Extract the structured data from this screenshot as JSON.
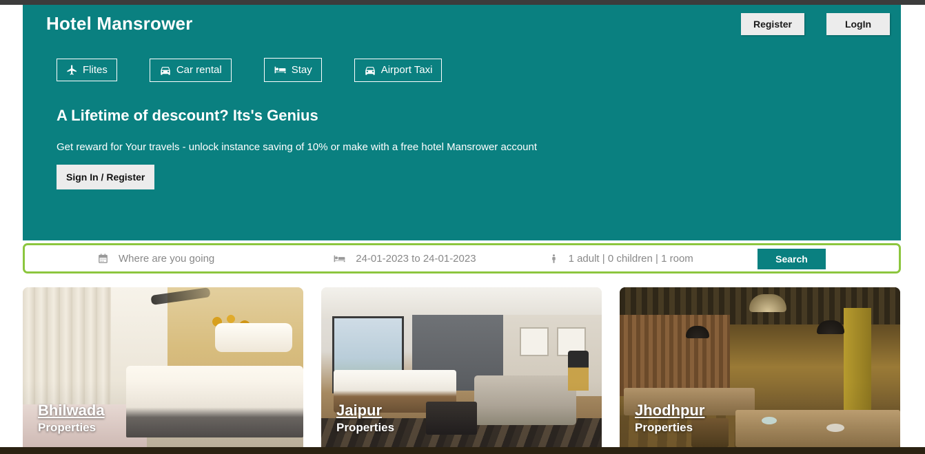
{
  "header": {
    "brand": "Hotel Mansrower",
    "register_label": "Register",
    "login_label": "LogIn"
  },
  "nav": {
    "items": [
      {
        "label": "Flites",
        "icon": "plane-icon"
      },
      {
        "label": "Car rental",
        "icon": "car-icon"
      },
      {
        "label": "Stay",
        "icon": "bed-icon"
      },
      {
        "label": "Airport Taxi",
        "icon": "taxi-icon"
      }
    ]
  },
  "promo": {
    "title": "A Lifetime of descount? Its's Genius",
    "subtitle": "Get reward for Your travels - unlock instance saving of 10% or make with a free hotel Mansrower account",
    "button_label": "Sign In / Register"
  },
  "search": {
    "destination_placeholder": "Where are you going",
    "destination_icon": "calendar-icon",
    "dates_value": "24-01-2023 to 24-01-2023",
    "dates_icon": "bed-icon",
    "guests_value": "1 adult | 0 children | 1 room",
    "guests_icon": "person-icon",
    "search_button_label": "Search"
  },
  "properties": {
    "subtitle": "Properties",
    "cards": [
      {
        "city": "Bhilwada",
        "subtitle": "Properties"
      },
      {
        "city": "Jaipur",
        "subtitle": "Properties"
      },
      {
        "city": "Jhodhpur",
        "subtitle": "Properties"
      }
    ]
  },
  "colors": {
    "brand_teal": "#0a8080",
    "accent_green": "#8cc63e",
    "button_grey": "#ececec"
  }
}
